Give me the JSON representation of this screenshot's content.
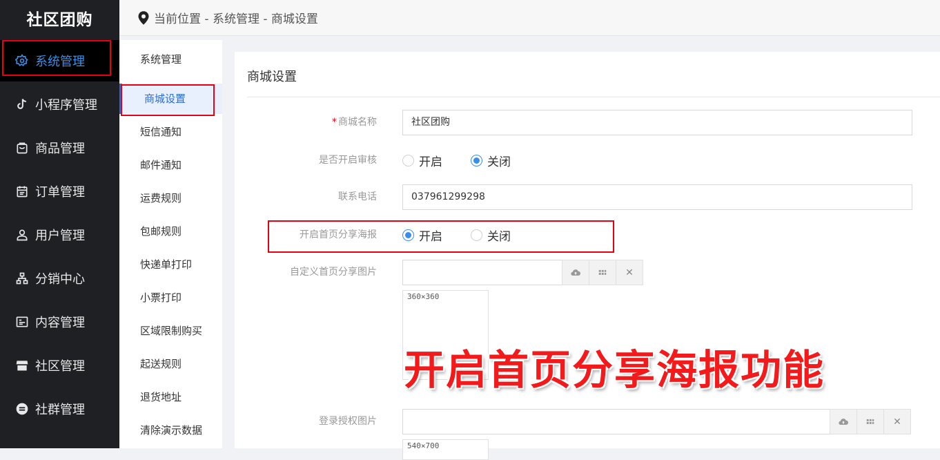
{
  "app": {
    "brand": "社区团购"
  },
  "sidebar": {
    "items": [
      {
        "label": "系统管理",
        "icon": "gear-icon",
        "active": true
      },
      {
        "label": "小程序管理",
        "icon": "tiktok-icon",
        "active": false
      },
      {
        "label": "商品管理",
        "icon": "bag-icon",
        "active": false
      },
      {
        "label": "订单管理",
        "icon": "calendar-icon",
        "active": false
      },
      {
        "label": "用户管理",
        "icon": "user-icon",
        "active": false
      },
      {
        "label": "分销中心",
        "icon": "hierarchy-icon",
        "active": false
      },
      {
        "label": "内容管理",
        "icon": "content-icon",
        "active": false
      },
      {
        "label": "社区管理",
        "icon": "store-icon",
        "active": false
      },
      {
        "label": "社群管理",
        "icon": "group-icon",
        "active": false
      }
    ]
  },
  "breadcrumb": {
    "text": "当前位置 - 系统管理 - 商城设置"
  },
  "subnav": {
    "items": [
      {
        "label": "系统管理"
      },
      {
        "label": "商城设置",
        "active": true
      },
      {
        "label": "短信通知"
      },
      {
        "label": "邮件通知"
      },
      {
        "label": "运费规则"
      },
      {
        "label": "包邮规则"
      },
      {
        "label": "快递单打印"
      },
      {
        "label": "小票打印"
      },
      {
        "label": "区域限制购买"
      },
      {
        "label": "起送规则"
      },
      {
        "label": "退货地址"
      },
      {
        "label": "清除演示数据"
      }
    ]
  },
  "form": {
    "title": "商城设置",
    "shop_name": {
      "label": "商城名称",
      "required_mark": "*",
      "value": "社区团购"
    },
    "review": {
      "label": "是否开启审核",
      "options": [
        "开启",
        "关闭"
      ],
      "selected": "关闭"
    },
    "phone": {
      "label": "联系电话",
      "value": "037961299298"
    },
    "share_poster": {
      "label": "开启首页分享海报",
      "options": [
        "开启",
        "关闭"
      ],
      "selected": "开启"
    },
    "share_image": {
      "label": "自定义首页分享图片",
      "value": "",
      "preview_size": "360×360"
    },
    "login_image": {
      "label": "登录授权图片",
      "value": "",
      "preview_size": "540×700"
    }
  },
  "overlay": {
    "text": "开启首页分享海报功能"
  },
  "colors": {
    "accent": "#3a8ee6",
    "highlight_red": "#e60012",
    "sidebar_bg": "#1f2024"
  }
}
